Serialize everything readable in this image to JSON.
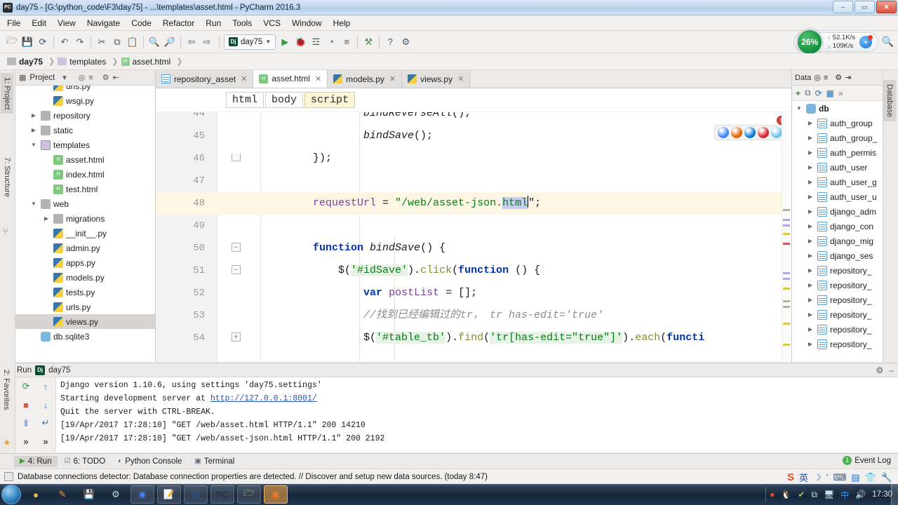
{
  "window": {
    "title": "day75 - [G:\\python_code\\F3\\day75] - ...\\templates\\asset.html - PyCharm 2016.3",
    "app_icon": "PC",
    "minimize": "–",
    "maximize": "▭",
    "close": "✕"
  },
  "menubar": [
    "File",
    "Edit",
    "View",
    "Navigate",
    "Code",
    "Refactor",
    "Run",
    "Tools",
    "VCS",
    "Window",
    "Help"
  ],
  "toolbar": {
    "icons": [
      {
        "name": "open-folder-icon",
        "glyph": "🗁"
      },
      {
        "name": "save-all-icon",
        "glyph": "💾"
      },
      {
        "name": "sync-icon",
        "glyph": "⟳"
      },
      {
        "name": "undo-icon",
        "glyph": "↶"
      },
      {
        "name": "redo-icon",
        "glyph": "↷"
      },
      {
        "name": "cut-icon",
        "glyph": "✂"
      },
      {
        "name": "copy-icon",
        "glyph": "⧉"
      },
      {
        "name": "paste-icon",
        "glyph": "📋"
      },
      {
        "name": "find-icon",
        "glyph": "🔍"
      },
      {
        "name": "replace-icon",
        "glyph": "🔎"
      },
      {
        "name": "back-icon",
        "glyph": "⇦"
      },
      {
        "name": "forward-icon",
        "glyph": "⇨"
      }
    ],
    "run_config": "day75",
    "run_config_icon": "Dj",
    "action_icons": [
      {
        "name": "run-icon",
        "glyph": "▶"
      },
      {
        "name": "debug-icon",
        "glyph": "🐞"
      },
      {
        "name": "coverage-icon",
        "glyph": "☲"
      },
      {
        "name": "profile-icon",
        "glyph": "◔"
      },
      {
        "name": "stop-icon",
        "glyph": "≡"
      },
      {
        "name": "attach-icon",
        "glyph": "⚒"
      },
      {
        "name": "help-icon",
        "glyph": "?"
      },
      {
        "name": "settings-icon",
        "glyph": "⚙"
      }
    ],
    "search_icon": "🔍"
  },
  "network_widget": {
    "cpu_percent": "26%",
    "upload": "52.1K/s",
    "download": "109K/s",
    "up_arrow": "↑",
    "down_arrow": "↓",
    "plus_glyph": "+"
  },
  "breadcrumb": [
    {
      "label": "day75",
      "icon": "folder-icon",
      "bold": true
    },
    {
      "label": "templates",
      "icon": "folder-open-icon",
      "bold": false
    },
    {
      "label": "asset.html",
      "icon": "html-file-icon",
      "bold": false
    }
  ],
  "left_strips": [
    {
      "label": "1: Project",
      "active": true
    },
    {
      "label": "7: Structure",
      "active": false
    }
  ],
  "right_strip": {
    "label": "Database"
  },
  "project_panel": {
    "title": "Project",
    "head_icons": [
      "chevron-down-icon",
      "target-icon",
      "collapse-icon",
      "gear-icon",
      "hide-icon"
    ],
    "tree": [
      {
        "label": "urls.py",
        "indent": 2,
        "icon": "py",
        "twisty": "",
        "selected": false
      },
      {
        "label": "wsgi.py",
        "indent": 2,
        "icon": "py",
        "twisty": "",
        "selected": false
      },
      {
        "label": "repository",
        "indent": 1,
        "icon": "fold",
        "twisty": "▶",
        "selected": false
      },
      {
        "label": "static",
        "indent": 1,
        "icon": "fold",
        "twisty": "▶",
        "selected": false
      },
      {
        "label": "templates",
        "indent": 1,
        "icon": "foldopen",
        "twisty": "▼",
        "selected": false
      },
      {
        "label": "asset.html",
        "indent": 2,
        "icon": "html",
        "twisty": "",
        "selected": false
      },
      {
        "label": "index.html",
        "indent": 2,
        "icon": "html",
        "twisty": "",
        "selected": false
      },
      {
        "label": "test.html",
        "indent": 2,
        "icon": "html",
        "twisty": "",
        "selected": false
      },
      {
        "label": "web",
        "indent": 1,
        "icon": "fold",
        "twisty": "▼",
        "selected": false
      },
      {
        "label": "migrations",
        "indent": 2,
        "icon": "fold",
        "twisty": "▶",
        "selected": false
      },
      {
        "label": "__init__.py",
        "indent": 2,
        "icon": "py",
        "twisty": "",
        "selected": false
      },
      {
        "label": "admin.py",
        "indent": 2,
        "icon": "py",
        "twisty": "",
        "selected": false
      },
      {
        "label": "apps.py",
        "indent": 2,
        "icon": "py",
        "twisty": "",
        "selected": false
      },
      {
        "label": "models.py",
        "indent": 2,
        "icon": "py",
        "twisty": "",
        "selected": false
      },
      {
        "label": "tests.py",
        "indent": 2,
        "icon": "py",
        "twisty": "",
        "selected": false
      },
      {
        "label": "urls.py",
        "indent": 2,
        "icon": "py",
        "twisty": "",
        "selected": false
      },
      {
        "label": "views.py",
        "indent": 2,
        "icon": "py",
        "twisty": "",
        "selected": true
      },
      {
        "label": "db.sqlite3",
        "indent": 1,
        "icon": "db",
        "twisty": "",
        "selected": false
      }
    ]
  },
  "editor": {
    "tabs": [
      {
        "label": "repository_asset",
        "icon": "table-icon",
        "active": false,
        "close": "✕"
      },
      {
        "label": "asset.html",
        "icon": "html-file-icon",
        "active": true,
        "close": "✕"
      },
      {
        "label": "models.py",
        "icon": "py-file-icon",
        "active": false,
        "close": "✕"
      },
      {
        "label": "views.py",
        "icon": "py-file-icon",
        "active": false,
        "close": "✕"
      }
    ],
    "structure_crumbs": [
      {
        "label": "html",
        "selected": false
      },
      {
        "label": "body",
        "selected": false
      },
      {
        "label": "script",
        "selected": true
      }
    ],
    "browser_icons": [
      {
        "name": "chrome-icon",
        "color": "#4285f4"
      },
      {
        "name": "firefox-icon",
        "color": "#e66000"
      },
      {
        "name": "edge-icon",
        "color": "#0f78d4"
      },
      {
        "name": "opera-icon",
        "color": "#d6242b"
      },
      {
        "name": "safari-icon",
        "color": "#6fc3e8"
      }
    ],
    "error_badge": "!",
    "lines": [
      {
        "num": "44",
        "fold": "",
        "highlight": false,
        "clip_top": true,
        "tokens": [
          {
            "t": "                ",
            "c": "plain"
          },
          {
            "t": "bindReverseAll",
            "c": "fn"
          },
          {
            "t": "();",
            "c": "plain"
          }
        ]
      },
      {
        "num": "45",
        "fold": "",
        "highlight": false,
        "tokens": [
          {
            "t": "                ",
            "c": "plain"
          },
          {
            "t": "bindSave",
            "c": "fn"
          },
          {
            "t": "();",
            "c": "plain"
          }
        ]
      },
      {
        "num": "46",
        "fold": "end",
        "highlight": false,
        "tokens": [
          {
            "t": "        });",
            "c": "plain"
          }
        ]
      },
      {
        "num": "47",
        "fold": "",
        "highlight": false,
        "tokens": []
      },
      {
        "num": "48",
        "fold": "",
        "highlight": true,
        "tokens": [
          {
            "t": "        ",
            "c": "plain"
          },
          {
            "t": "requestUrl",
            "c": "var"
          },
          {
            "t": " = ",
            "c": "plain"
          },
          {
            "t": "\"/web/asset-json.",
            "c": "str"
          },
          {
            "t": "html",
            "c": "str-sel"
          },
          {
            "t": "\";",
            "c": "plain"
          }
        ]
      },
      {
        "num": "49",
        "fold": "",
        "highlight": false,
        "tokens": []
      },
      {
        "num": "50",
        "fold": "collapse",
        "highlight": false,
        "tokens": [
          {
            "t": "        ",
            "c": "plain"
          },
          {
            "t": "function",
            "c": "k"
          },
          {
            "t": " ",
            "c": "plain"
          },
          {
            "t": "bindSave",
            "c": "fn"
          },
          {
            "t": "() {",
            "c": "plain"
          }
        ]
      },
      {
        "num": "51",
        "fold": "collapse",
        "highlight": false,
        "tokens": [
          {
            "t": "            ",
            "c": "plain"
          },
          {
            "t": "$(",
            "c": "plain"
          },
          {
            "t": "'#idSave'",
            "c": "str-green"
          },
          {
            "t": ")",
            "c": "plain"
          },
          {
            "t": ".",
            "c": "plain"
          },
          {
            "t": "click",
            "c": "jq"
          },
          {
            "t": "(",
            "c": "plain"
          },
          {
            "t": "function",
            "c": "k"
          },
          {
            "t": " () {",
            "c": "plain"
          }
        ]
      },
      {
        "num": "52",
        "fold": "",
        "highlight": false,
        "tokens": [
          {
            "t": "                ",
            "c": "plain"
          },
          {
            "t": "var",
            "c": "k"
          },
          {
            "t": " ",
            "c": "plain"
          },
          {
            "t": "postList",
            "c": "var"
          },
          {
            "t": " = [];",
            "c": "plain"
          }
        ]
      },
      {
        "num": "53",
        "fold": "",
        "highlight": false,
        "tokens": [
          {
            "t": "                ",
            "c": "plain"
          },
          {
            "t": "//找到已经编辑过的tr， tr has-edit='true'",
            "c": "cmt"
          }
        ]
      },
      {
        "num": "54",
        "fold": "expand",
        "highlight": false,
        "clip_bottom": true,
        "tokens": [
          {
            "t": "                ",
            "c": "plain"
          },
          {
            "t": "$(",
            "c": "plain"
          },
          {
            "t": "'#table_tb'",
            "c": "str-green"
          },
          {
            "t": ")",
            "c": "plain"
          },
          {
            "t": ".",
            "c": "plain"
          },
          {
            "t": "find",
            "c": "jq"
          },
          {
            "t": "(",
            "c": "plain"
          },
          {
            "t": "'tr[has-edit=\"true\"]'",
            "c": "str-green"
          },
          {
            "t": ")",
            "c": "plain"
          },
          {
            "t": ".",
            "c": "plain"
          },
          {
            "t": "each",
            "c": "jq"
          },
          {
            "t": "(",
            "c": "plain"
          },
          {
            "t": "functi",
            "c": "k"
          }
        ]
      }
    ]
  },
  "db_panel": {
    "title": "Data",
    "head_icons": [
      "target-icon",
      "collapse-icon",
      "gear-icon",
      "hide-icon"
    ],
    "tool_icons": [
      "plus-icon",
      "copy-icon",
      "refresh-icon",
      "console-icon",
      "more-icon"
    ],
    "root": {
      "label": "db",
      "icon": "db-icon",
      "twisty": "▼"
    },
    "tables": [
      "auth_group",
      "auth_group_",
      "auth_permis",
      "auth_user",
      "auth_user_g",
      "auth_user_u",
      "django_adm",
      "django_con",
      "django_mig",
      "django_ses",
      "repository_",
      "repository_",
      "repository_",
      "repository_",
      "repository_",
      "repository_"
    ]
  },
  "run_panel": {
    "title": "Run",
    "config_icon": "Dj",
    "config_name": "day75",
    "right_icons": [
      "gear-icon",
      "hide-icon"
    ],
    "side_icons": [
      {
        "name": "rerun-icon",
        "glyph": "⟳"
      },
      {
        "name": "stop-icon",
        "glyph": "■"
      },
      {
        "name": "pause-icon",
        "glyph": "‖"
      },
      {
        "name": "up-icon",
        "glyph": "↑"
      },
      {
        "name": "down-icon",
        "glyph": "↓"
      },
      {
        "name": "soft-wrap-icon",
        "glyph": "↵"
      },
      {
        "name": "expand-icon",
        "glyph": "»"
      },
      {
        "name": "expand2-icon",
        "glyph": "»"
      }
    ],
    "console": [
      {
        "text": "Django version 1.10.6, using settings 'day75.settings'",
        "link": null,
        "clip": true
      },
      {
        "text": "Starting development server at ",
        "link": "http://127.0.0.1:8001/"
      },
      {
        "text": "Quit the server with CTRL-BREAK.",
        "link": null
      },
      {
        "text": "[19/Apr/2017 17:28:10] \"GET /web/asset.html HTTP/1.1\" 200 14210",
        "link": null
      },
      {
        "text": "[19/Apr/2017 17:28:10] \"GET /web/asset-json.html HTTP/1.1\" 200 2192",
        "link": null
      }
    ]
  },
  "tool_tabs": [
    {
      "label": "4: Run",
      "icon": "run-icon",
      "active": true
    },
    {
      "label": "6: TODO",
      "icon": "todo-icon",
      "active": false
    },
    {
      "label": "Python Console",
      "icon": "python-icon",
      "active": false
    },
    {
      "label": "Terminal",
      "icon": "terminal-icon",
      "active": false
    }
  ],
  "event_log": {
    "label": "Event Log",
    "count": "1"
  },
  "statusbar": {
    "message": "Database connections detector: Database connection properties are detected. // Discover and setup new data sources. (today 8:47)",
    "icon": "info-icon",
    "tray_icons": [
      {
        "name": "sogou-icon",
        "glyph": "S",
        "color": "#ef4b23"
      },
      {
        "name": "ime-chinese-icon",
        "glyph": "英",
        "color": "#1f5fa8"
      },
      {
        "name": "moon-icon",
        "glyph": "☽",
        "color": "#2a6fb5"
      },
      {
        "name": "comma-icon",
        "glyph": "’",
        "color": "#2a6fb5"
      },
      {
        "name": "keyboard-icon",
        "glyph": "⌨",
        "color": "#3c5a78"
      },
      {
        "name": "toolbox-icon",
        "glyph": "▤",
        "color": "#2a6fb5"
      },
      {
        "name": "shirt-icon",
        "glyph": "👕",
        "color": "#2a6fb5"
      },
      {
        "name": "wrench-icon",
        "glyph": "🔧",
        "color": "#2a6fb5"
      }
    ]
  },
  "taskbar": {
    "start_label": "Start",
    "items": [
      {
        "name": "taskbar-media-icon",
        "glyph": "●",
        "color": "#e8c54a",
        "style": "plain"
      },
      {
        "name": "taskbar-paint-icon",
        "glyph": "✎",
        "color": "#e89a4a",
        "style": "plain"
      },
      {
        "name": "taskbar-save-icon",
        "glyph": "💾",
        "color": "#dcdcdc",
        "style": "plain"
      },
      {
        "name": "taskbar-tool-icon",
        "glyph": "⚙",
        "color": "#c8d8e8",
        "style": "plain"
      },
      {
        "name": "taskbar-chrome-icon",
        "glyph": "◉",
        "color": "#4285f4",
        "style": "pinned"
      },
      {
        "name": "taskbar-notepad-icon",
        "glyph": "📝",
        "color": "#e8e8a0",
        "style": "pinned"
      },
      {
        "name": "taskbar-word-icon",
        "glyph": "W",
        "color": "#2b579a",
        "style": "pinned"
      },
      {
        "name": "taskbar-pycharm-icon",
        "glyph": "PC",
        "color": "#2b2b2b",
        "style": "pinned"
      },
      {
        "name": "taskbar-folder-icon",
        "glyph": "🗁",
        "color": "#d8c98a",
        "style": "pinned"
      },
      {
        "name": "taskbar-app-icon",
        "glyph": "▣",
        "color": "#e87b2a",
        "style": "active"
      }
    ],
    "tray": [
      {
        "name": "tray-record-icon",
        "glyph": "●",
        "color": "#e8452a"
      },
      {
        "name": "tray-qq-icon",
        "glyph": "🐧",
        "color": "#f0f0f0"
      },
      {
        "name": "tray-security-icon",
        "glyph": "✔",
        "color": "#7ed957"
      },
      {
        "name": "tray-share-icon",
        "glyph": "⧉",
        "color": "#cfe0f0"
      },
      {
        "name": "tray-network-icon",
        "glyph": "🖥",
        "color": "#cfe0f0"
      },
      {
        "name": "tray-ime-icon",
        "glyph": "中",
        "color": "#4a9be8"
      },
      {
        "name": "tray-volume-icon",
        "glyph": "🔊",
        "color": "#dfe8f2"
      }
    ],
    "clock": "17:30"
  }
}
